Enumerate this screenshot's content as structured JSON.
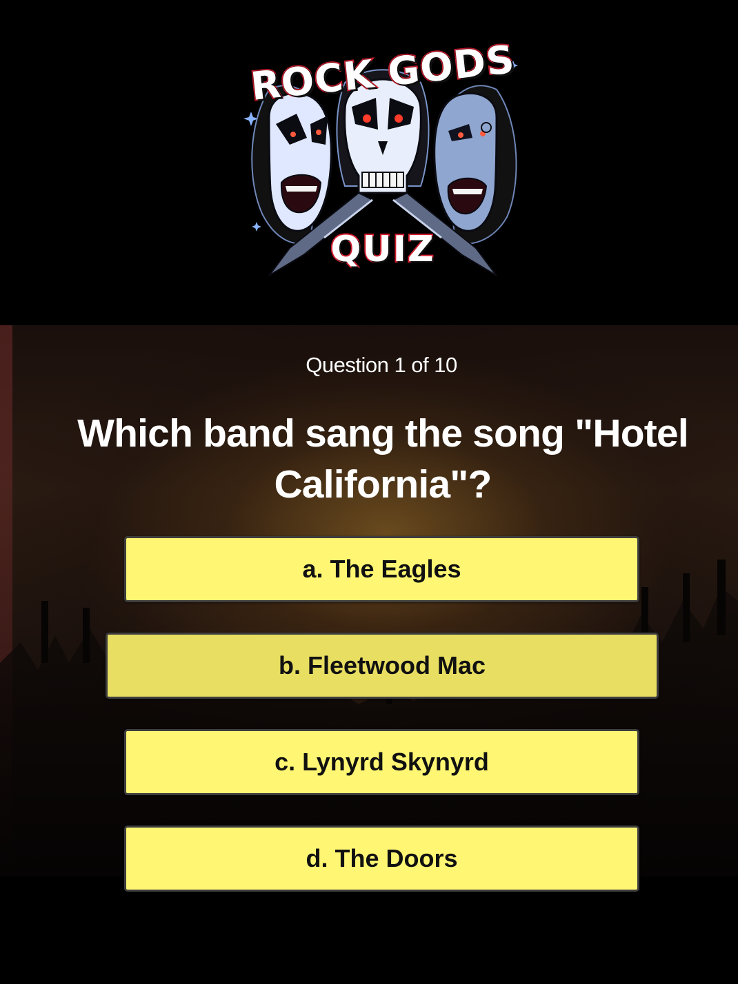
{
  "logo": {
    "title": "ROCK GODS",
    "subtitle": "QUIZ"
  },
  "quiz": {
    "counter": "Question 1 of 10",
    "question": "Which band sang the song \"Hotel California\"?",
    "answers": [
      {
        "label": "a. The Eagles",
        "state": "normal"
      },
      {
        "label": "b. Fleetwood Mac",
        "state": "hovered"
      },
      {
        "label": "c. Lynyrd Skynyrd",
        "state": "normal"
      },
      {
        "label": "d. The Doors",
        "state": "normal"
      }
    ]
  },
  "colors": {
    "answer_bg": "#fff773",
    "answer_hover_bg": "#e8de61",
    "answer_border": "#3e3e3e",
    "logo_accent": "#d11d2f",
    "page_bg": "#000000"
  }
}
